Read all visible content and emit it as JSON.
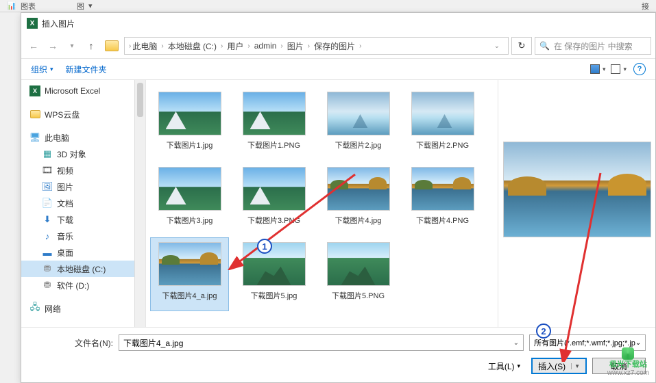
{
  "ribbon": {
    "label_chart": "图表",
    "label_pic": "图",
    "label_link": "接"
  },
  "dialog": {
    "title": "插入图片"
  },
  "nav": {
    "breadcrumbs": [
      "此电脑",
      "本地磁盘 (C:)",
      "用户",
      "admin",
      "图片",
      "保存的图片"
    ],
    "search_placeholder": "在 保存的图片 中搜索"
  },
  "toolbar": {
    "organize": "组织",
    "new_folder": "新建文件夹"
  },
  "sidebar": {
    "items": [
      {
        "label": "Microsoft Excel",
        "icon": "excel",
        "lvl": 0
      },
      {
        "label": "WPS云盘",
        "icon": "folder",
        "lvl": 0
      },
      {
        "label": "此电脑",
        "icon": "pc",
        "lvl": 0
      },
      {
        "label": "3D 对象",
        "icon": "3d",
        "lvl": 1
      },
      {
        "label": "视频",
        "icon": "video",
        "lvl": 1
      },
      {
        "label": "图片",
        "icon": "pic",
        "lvl": 1
      },
      {
        "label": "文档",
        "icon": "doc",
        "lvl": 1
      },
      {
        "label": "下载",
        "icon": "dl",
        "lvl": 1
      },
      {
        "label": "音乐",
        "icon": "music",
        "lvl": 1
      },
      {
        "label": "桌面",
        "icon": "desk",
        "lvl": 1
      },
      {
        "label": "本地磁盘 (C:)",
        "icon": "drive",
        "lvl": 1,
        "selected": true
      },
      {
        "label": "软件 (D:)",
        "icon": "drive",
        "lvl": 1
      },
      {
        "label": "网络",
        "icon": "net",
        "lvl": 0
      }
    ]
  },
  "files": [
    {
      "name": "下载图片1.jpg",
      "thumb": "mountain"
    },
    {
      "name": "下载图片1.PNG",
      "thumb": "mountain"
    },
    {
      "name": "下载图片2.jpg",
      "thumb": "misty"
    },
    {
      "name": "下载图片2.PNG",
      "thumb": "misty"
    },
    {
      "name": "下载图片3.jpg",
      "thumb": "mountain"
    },
    {
      "name": "下载图片3.PNG",
      "thumb": "mountain"
    },
    {
      "name": "下载图片4.jpg",
      "thumb": "lake"
    },
    {
      "name": "下载图片4.PNG",
      "thumb": "lake"
    },
    {
      "name": "下载图片4_a.jpg",
      "thumb": "lake",
      "selected": true
    },
    {
      "name": "下载图片5.jpg",
      "thumb": "greenval"
    },
    {
      "name": "下载图片5.PNG",
      "thumb": "greenval"
    }
  ],
  "bottom": {
    "filename_label": "文件名(N):",
    "filename_value": "下载图片4_a.jpg",
    "filter": "所有图片(*.emf;*.wmf;*.jpg;*.jp",
    "tools": "工具(L)",
    "insert": "插入(S)",
    "cancel": "取消"
  },
  "annotations": {
    "num1": "1",
    "num2": "2"
  },
  "watermark": {
    "line1": "极光下载站",
    "line2": "www.xz7.com"
  }
}
